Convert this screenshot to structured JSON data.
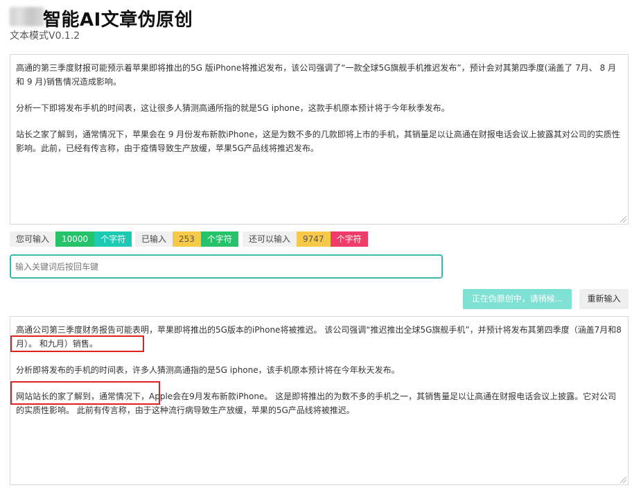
{
  "header": {
    "title": "智能AI文章伪原创",
    "version": "文本模式V0.1.2"
  },
  "source_text": {
    "paragraphs": [
      "高通的第三季度财报可能预示着苹果即将推出的5G 版iPhone将推迟发布，该公司强调了“一款全球5G旗舰手机推迟发布”，预计会对其第四季度(涵盖了 7月、 8 月和 9 月)销售情况造成影响。",
      "分析一下即将发布手机的时间表，这让很多人猜测高通所指的就是5G iphone，这款手机原本预计将于今年秋季发布。",
      "站长之家了解到，通常情况下，苹果会在 9 月份发布新款iPhone，这是为数不多的几款即将上市的手机，其销量足以让高通在财报电话会议上披露其对公司的实质性影响。此前，已经有传言称，由于疫情导致生产放缓，苹果5G产品线将推迟发布。"
    ]
  },
  "counters": {
    "allowed_label": "您可输入",
    "allowed_value": "10000",
    "entered_label": "已输入",
    "entered_value": "253",
    "remaining_label": "还可以输入",
    "remaining_value": "9747",
    "unit": "个字符"
  },
  "keyword_input": {
    "placeholder": "输入关键词后按回车键",
    "value": ""
  },
  "buttons": {
    "processing_label": "正在伪原创中，请稍候...",
    "reset_label": "重新输入"
  },
  "output_text": {
    "paragraphs": [
      "高通公司第三季度财务报告可能表明，苹果即将推出的5G版本的iPhone将被推迟。 该公司强调“推迟推出全球5G旗舰手机”，并预计将发布其第四季度（涵盖7月和8月）。 和九月）销售。",
      "分析即将发布的手机的时间表，许多人猜测高通指的是5G iphone，该手机原本预计将在今年秋天发布。",
      "网站站长的家了解到，通常情况下，Apple会在9月发布新款iPhone。 这是即将推出的为数不多的手机之一，其销售量足以让高通在财报电话会议上披露。它对公司的实质性影响。 此前有传言称，由于这种流行病导致生产放缓，苹果的5G产品线将被推迟。"
    ]
  },
  "colors": {
    "accent_teal": "#3bb7a8",
    "button_disabled_teal": "#7fe0d4",
    "highlight_red": "#e02020",
    "badge_green": "#25c26a",
    "badge_yellow": "#f7c948",
    "badge_red": "#ef3d6a"
  }
}
